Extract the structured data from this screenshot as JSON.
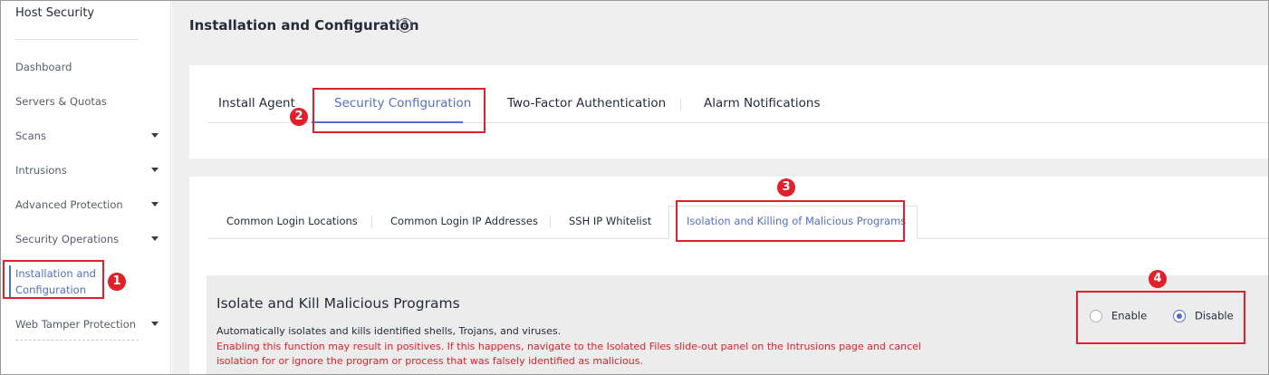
{
  "sidebar": {
    "title": "Host Security",
    "items": [
      {
        "label": "Dashboard",
        "has_caret": false
      },
      {
        "label": "Servers & Quotas",
        "has_caret": false
      },
      {
        "label": "Scans",
        "has_caret": true
      },
      {
        "label": "Intrusions",
        "has_caret": true
      },
      {
        "label": "Advanced Protection",
        "has_caret": true
      },
      {
        "label": "Security Operations",
        "has_caret": true
      },
      {
        "label_line1": "Installation and",
        "label_line2": "Configuration",
        "active": true
      },
      {
        "label": "Web Tamper Protection",
        "has_caret": true
      }
    ]
  },
  "page": {
    "title": "Installation and Configuration",
    "help_icon": "?"
  },
  "top_tabs": [
    {
      "label": "Install Agent"
    },
    {
      "label": "Security Configuration",
      "active": true
    },
    {
      "label": "Two-Factor Authentication"
    },
    {
      "label": "Alarm Notifications"
    }
  ],
  "sub_tabs": [
    {
      "label": "Common Login Locations"
    },
    {
      "label": "Common Login IP Addresses"
    },
    {
      "label": "SSH IP Whitelist"
    },
    {
      "label": "Isolation and Killing of Malicious Programs",
      "active": true
    }
  ],
  "panel": {
    "title": "Isolate and Kill Malicious Programs",
    "description": "Automatically isolates and kills identified shells, Trojans, and viruses.",
    "warning": "Enabling this function may result in positives. If this happens, navigate to the Isolated Files slide-out panel on the Intrusions page and cancel isolation for or ignore the program or process that was falsely identified as malicious.",
    "options": [
      {
        "label": "Enable",
        "checked": false
      },
      {
        "label": "Disable",
        "checked": true
      }
    ]
  },
  "annotations": [
    "1",
    "2",
    "3",
    "4"
  ],
  "colors": {
    "accent": "#526ecc",
    "annotation_red": "#e0202b",
    "warning_text": "#e0202b",
    "background": "#efefef"
  }
}
